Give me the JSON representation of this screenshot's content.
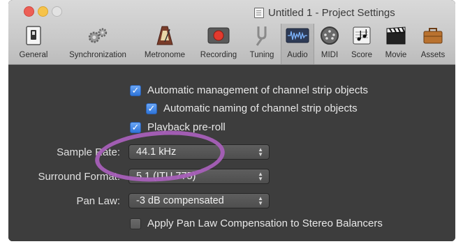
{
  "window": {
    "title": "Untitled 1 - Project Settings",
    "title_icon": "document-icon"
  },
  "toolbar": {
    "items": [
      {
        "label": "General",
        "icon": "switch-icon"
      },
      {
        "label": "Synchronization",
        "icon": "gears-icon"
      },
      {
        "label": "Metronome",
        "icon": "metronome-icon"
      },
      {
        "label": "Recording",
        "icon": "record-icon"
      },
      {
        "label": "Tuning",
        "icon": "tuning-fork-icon"
      },
      {
        "label": "Audio",
        "icon": "audio-waveform-icon",
        "active": true
      },
      {
        "label": "MIDI",
        "icon": "midi-connector-icon"
      },
      {
        "label": "Score",
        "icon": "score-icon"
      },
      {
        "label": "Movie",
        "icon": "clapperboard-icon"
      },
      {
        "label": "Assets",
        "icon": "briefcase-icon"
      }
    ]
  },
  "audio": {
    "auto_management_label": "Automatic management of channel strip objects",
    "auto_management_checked": true,
    "auto_naming_label": "Automatic naming of channel strip objects",
    "auto_naming_checked": true,
    "playback_preroll_label": "Playback pre-roll",
    "playback_preroll_checked": true,
    "sample_rate_label": "Sample Rate:",
    "sample_rate_value": "44.1 kHz",
    "surround_format_label": "Surround Format:",
    "surround_format_value": "5.1 (ITU 775)",
    "pan_law_label": "Pan Law:",
    "pan_law_value": "-3 dB compensated",
    "apply_pan_law_label": "Apply Pan Law Compensation to Stereo Balancers",
    "apply_pan_law_checked": false
  },
  "colors": {
    "annotation": "#a65fb8",
    "checkbox_checked": "#2e74d9",
    "panel_background": "#3d3d3d"
  }
}
